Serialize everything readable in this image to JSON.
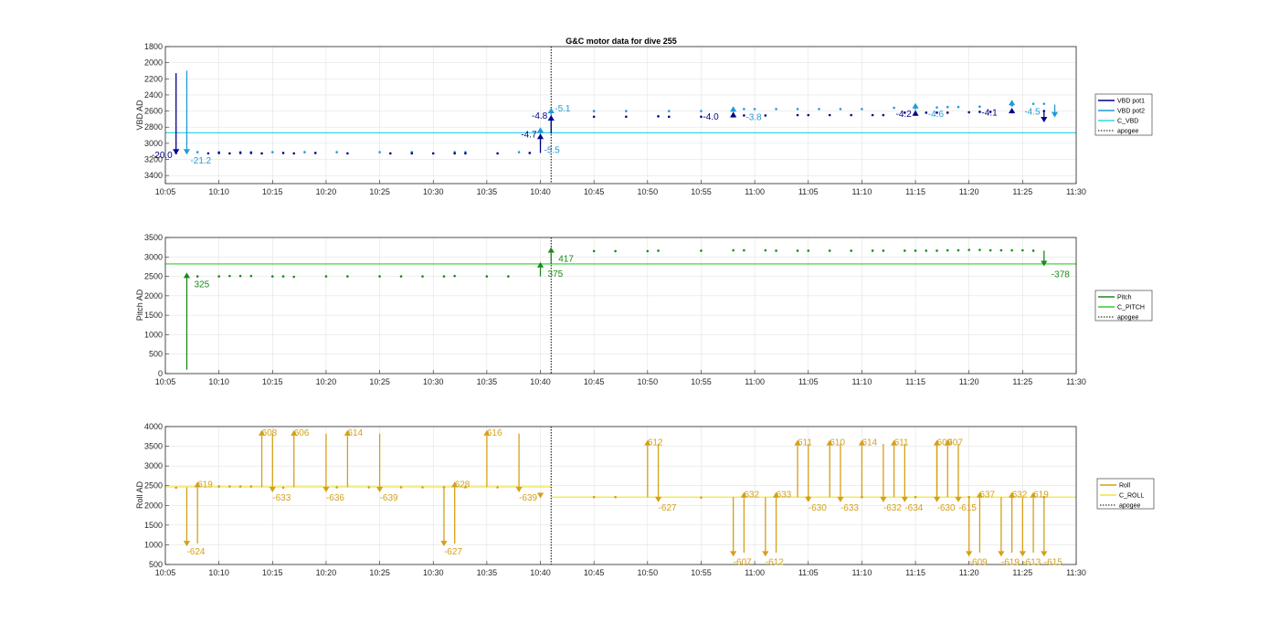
{
  "chart_data": [
    {
      "type": "line",
      "id": "vbd",
      "title": "G&C motor data for dive 255",
      "xlabel": "",
      "ylabel": "VBD AD",
      "x_ticks": [
        "10:05",
        "10:10",
        "10:15",
        "10:20",
        "10:25",
        "10:30",
        "10:35",
        "10:40",
        "10:45",
        "10:50",
        "10:55",
        "11:00",
        "11:05",
        "11:10",
        "11:15",
        "11:20",
        "11:25",
        "11:30"
      ],
      "xlim": [
        "10:05",
        "11:30"
      ],
      "ylim": [
        1800,
        3500
      ],
      "y_reversed": true,
      "y_ticks": [
        1800,
        2000,
        2200,
        2400,
        2600,
        2800,
        3000,
        3200,
        3400
      ],
      "grid": true,
      "legend_position": "right",
      "legend": [
        {
          "label": "VBD pot1",
          "color": "#00008b",
          "style": "solid"
        },
        {
          "label": "VBD pot2",
          "color": "#1f9bd8",
          "style": "solid"
        },
        {
          "label": "C_VBD",
          "color": "#33d6e6",
          "style": "solid"
        },
        {
          "label": "apogee",
          "color": "#000000",
          "style": "dotted"
        }
      ],
      "c_vbd": 2870,
      "apogee_x": "10:41",
      "pot1_points": [
        [
          "10:06",
          3120
        ],
        [
          "10:09",
          3125
        ],
        [
          "10:10",
          3120
        ],
        [
          "10:11",
          3125
        ],
        [
          "10:12",
          3120
        ],
        [
          "10:13",
          3120
        ],
        [
          "10:14",
          3125
        ],
        [
          "10:16",
          3120
        ],
        [
          "10:17",
          3125
        ],
        [
          "10:19",
          3120
        ],
        [
          "10:22",
          3125
        ],
        [
          "10:26",
          3125
        ],
        [
          "10:28",
          3125
        ],
        [
          "10:30",
          3125
        ],
        [
          "10:32",
          3125
        ],
        [
          "10:33",
          3125
        ],
        [
          "10:36",
          3125
        ],
        [
          "10:39",
          3120
        ],
        [
          "10:45",
          2670
        ],
        [
          "10:48",
          2670
        ],
        [
          "10:51",
          2665
        ],
        [
          "10:52",
          2670
        ],
        [
          "10:55",
          2670
        ],
        [
          "10:58",
          2660
        ],
        [
          "10:59",
          2655
        ],
        [
          "11:01",
          2655
        ],
        [
          "11:04",
          2650
        ],
        [
          "11:05",
          2650
        ],
        [
          "11:07",
          2650
        ],
        [
          "11:09",
          2650
        ],
        [
          "11:11",
          2650
        ],
        [
          "11:12",
          2650
        ],
        [
          "11:14",
          2620
        ],
        [
          "11:15",
          2620
        ],
        [
          "11:16",
          2620
        ],
        [
          "11:17",
          2620
        ],
        [
          "11:18",
          2620
        ],
        [
          "11:20",
          2615
        ],
        [
          "11:21",
          2610
        ],
        [
          "11:22",
          2610
        ],
        [
          "11:24",
          2600
        ],
        [
          "11:27",
          2600
        ]
      ],
      "pot2_points": [
        [
          "10:07",
          3110
        ],
        [
          "10:08",
          3110
        ],
        [
          "10:10",
          3110
        ],
        [
          "10:12",
          3110
        ],
        [
          "10:13",
          3110
        ],
        [
          "10:15",
          3110
        ],
        [
          "10:18",
          3110
        ],
        [
          "10:21",
          3110
        ],
        [
          "10:25",
          3110
        ],
        [
          "10:28",
          3110
        ],
        [
          "10:32",
          3110
        ],
        [
          "10:33",
          3110
        ],
        [
          "10:38",
          3110
        ],
        [
          "10:45",
          2600
        ],
        [
          "10:48",
          2600
        ],
        [
          "10:52",
          2600
        ],
        [
          "10:55",
          2600
        ],
        [
          "10:59",
          2575
        ],
        [
          "11:00",
          2575
        ],
        [
          "11:02",
          2575
        ],
        [
          "11:04",
          2575
        ],
        [
          "11:06",
          2575
        ],
        [
          "11:08",
          2575
        ],
        [
          "11:10",
          2575
        ],
        [
          "11:13",
          2560
        ],
        [
          "11:17",
          2555
        ],
        [
          "11:18",
          2550
        ],
        [
          "11:19",
          2550
        ],
        [
          "11:21",
          2545
        ],
        [
          "11:24",
          2530
        ],
        [
          "11:26",
          2510
        ],
        [
          "11:27",
          2510
        ]
      ],
      "pot1_arrows": [
        {
          "x": "10:06",
          "y_start": 2130,
          "y_end": 3140,
          "label": "-20.0",
          "label_at": "end"
        },
        {
          "x": "10:40",
          "y_start": 3120,
          "y_end": 2880,
          "label": "-4.7",
          "label_at": "end"
        },
        {
          "x": "10:41",
          "y_start": 2880,
          "y_end": 2650,
          "label": "-4.8",
          "label_at": "end"
        },
        {
          "x": "10:58",
          "y_start": 2680,
          "y_end": 2610,
          "label": "",
          "label_at": "end"
        },
        {
          "x": "11:15",
          "y_start": 2660,
          "y_end": 2590,
          "label": "",
          "label_at": "end"
        },
        {
          "x": "11:24",
          "y_start": 2630,
          "y_end": 2560,
          "label": "",
          "label_at": "end"
        },
        {
          "x": "11:27",
          "y_start": 2600,
          "y_end": 2740,
          "label": "",
          "label_at": "end"
        }
      ],
      "pot2_arrows": [
        {
          "x": "10:07",
          "y_start": 2100,
          "y_end": 3140,
          "label": "-21.2",
          "label_at": "end"
        },
        {
          "x": "10:40",
          "y_start": 3020,
          "y_end": 2800,
          "label": "-5.5",
          "label_at": "start"
        },
        {
          "x": "10:41",
          "y_start": 2860,
          "y_end": 2560,
          "label": "-5.1",
          "label_at": "end"
        },
        {
          "x": "10:58",
          "y_start": 2620,
          "y_end": 2540,
          "label": "",
          "label_at": "end"
        },
        {
          "x": "11:15",
          "y_start": 2590,
          "y_end": 2500,
          "label": "",
          "label_at": "end"
        },
        {
          "x": "11:24",
          "y_start": 2540,
          "y_end": 2460,
          "label": "",
          "label_at": "end"
        },
        {
          "x": "11:28",
          "y_start": 2520,
          "y_end": 2680,
          "label": "",
          "label_at": "end"
        }
      ],
      "extra_labels": [
        {
          "x": "10:55",
          "y": 2660,
          "text": "-4.0",
          "color": "#00008b"
        },
        {
          "x": "10:59",
          "y": 2665,
          "text": "-3.8",
          "color": "#1f9bd8"
        },
        {
          "x": "11:13",
          "y": 2630,
          "text": "-4.2",
          "color": "#00008b"
        },
        {
          "x": "11:16",
          "y": 2630,
          "text": "-4.6",
          "color": "#1f9bd8"
        },
        {
          "x": "11:21",
          "y": 2610,
          "text": "-4.1",
          "color": "#00008b"
        },
        {
          "x": "11:25",
          "y": 2600,
          "text": "-4.5",
          "color": "#1f9bd8"
        }
      ]
    },
    {
      "type": "line",
      "id": "pitch",
      "title": "",
      "xlabel": "",
      "ylabel": "Pitch AD",
      "x_ticks": [
        "10:05",
        "10:10",
        "10:15",
        "10:20",
        "10:25",
        "10:30",
        "10:35",
        "10:40",
        "10:45",
        "10:50",
        "10:55",
        "11:00",
        "11:05",
        "11:10",
        "11:15",
        "11:20",
        "11:25",
        "11:30"
      ],
      "xlim": [
        "10:05",
        "11:30"
      ],
      "ylim": [
        0,
        3500
      ],
      "y_reversed": false,
      "y_ticks": [
        0,
        500,
        1000,
        1500,
        2000,
        2500,
        3000,
        3500
      ],
      "grid": true,
      "legend_position": "right",
      "legend": [
        {
          "label": "Pitch",
          "color": "#1a8a1a",
          "style": "solid"
        },
        {
          "label": "C_PITCH",
          "color": "#33cc33",
          "style": "solid"
        },
        {
          "label": "apogee",
          "color": "#000000",
          "style": "dotted"
        }
      ],
      "c_pitch": 2820,
      "apogee_x": "10:41",
      "points": [
        [
          "10:08",
          2500
        ],
        [
          "10:10",
          2500
        ],
        [
          "10:11",
          2510
        ],
        [
          "10:12",
          2510
        ],
        [
          "10:13",
          2510
        ],
        [
          "10:15",
          2500
        ],
        [
          "10:16",
          2500
        ],
        [
          "10:17",
          2490
        ],
        [
          "10:20",
          2500
        ],
        [
          "10:22",
          2500
        ],
        [
          "10:25",
          2500
        ],
        [
          "10:27",
          2500
        ],
        [
          "10:29",
          2500
        ],
        [
          "10:31",
          2500
        ],
        [
          "10:32",
          2510
        ],
        [
          "10:35",
          2500
        ],
        [
          "10:37",
          2500
        ],
        [
          "10:45",
          3150
        ],
        [
          "10:47",
          3150
        ],
        [
          "10:50",
          3150
        ],
        [
          "10:51",
          3160
        ],
        [
          "10:55",
          3160
        ],
        [
          "10:58",
          3170
        ],
        [
          "10:59",
          3170
        ],
        [
          "11:01",
          3170
        ],
        [
          "11:02",
          3160
        ],
        [
          "11:04",
          3160
        ],
        [
          "11:05",
          3160
        ],
        [
          "11:07",
          3160
        ],
        [
          "11:09",
          3160
        ],
        [
          "11:11",
          3160
        ],
        [
          "11:12",
          3160
        ],
        [
          "11:14",
          3160
        ],
        [
          "11:15",
          3160
        ],
        [
          "11:16",
          3160
        ],
        [
          "11:17",
          3160
        ],
        [
          "11:18",
          3170
        ],
        [
          "11:19",
          3170
        ],
        [
          "11:20",
          3180
        ],
        [
          "11:21",
          3180
        ],
        [
          "11:22",
          3170
        ],
        [
          "11:23",
          3170
        ],
        [
          "11:24",
          3170
        ],
        [
          "11:25",
          3170
        ],
        [
          "11:26",
          3160
        ]
      ],
      "arrows": [
        {
          "x": "10:07",
          "y_start": 100,
          "y_end": 2600,
          "label": "325"
        },
        {
          "x": "10:40",
          "y_start": 2500,
          "y_end": 2870,
          "label": "375"
        },
        {
          "x": "10:41",
          "y_start": 2870,
          "y_end": 3250,
          "label": "417"
        },
        {
          "x": "11:27",
          "y_start": 3160,
          "y_end": 2760,
          "label": "-378"
        }
      ]
    },
    {
      "type": "line",
      "id": "roll",
      "title": "",
      "xlabel": "",
      "ylabel": "Roll AD",
      "x_ticks": [
        "10:05",
        "10:10",
        "10:15",
        "10:20",
        "10:25",
        "10:30",
        "10:35",
        "10:40",
        "10:45",
        "10:50",
        "10:55",
        "11:00",
        "11:05",
        "11:10",
        "11:15",
        "11:20",
        "11:25",
        "11:30"
      ],
      "xlim": [
        "10:05",
        "11:30"
      ],
      "ylim": [
        500,
        4000
      ],
      "y_reversed": false,
      "y_ticks": [
        500,
        1000,
        1500,
        2000,
        2500,
        3000,
        3500,
        4000
      ],
      "grid": true,
      "legend_position": "right",
      "legend": [
        {
          "label": "Roll",
          "color": "#d4a017",
          "style": "solid"
        },
        {
          "label": "C_ROLL",
          "color": "#f0e442",
          "style": "solid"
        },
        {
          "label": "apogee",
          "color": "#000000",
          "style": "dotted"
        }
      ],
      "c_roll_before": 2470,
      "c_roll_after": 2210,
      "apogee_x": "10:41",
      "points": [
        [
          "10:06",
          2450
        ],
        [
          "10:10",
          2480
        ],
        [
          "10:11",
          2480
        ],
        [
          "10:12",
          2480
        ],
        [
          "10:13",
          2480
        ],
        [
          "10:16",
          2450
        ],
        [
          "10:21",
          2460
        ],
        [
          "10:24",
          2460
        ],
        [
          "10:27",
          2460
        ],
        [
          "10:29",
          2460
        ],
        [
          "10:31",
          2460
        ],
        [
          "10:33",
          2460
        ],
        [
          "10:36",
          2460
        ],
        [
          "10:45",
          2210
        ],
        [
          "10:47",
          2210
        ],
        [
          "10:55",
          2200
        ],
        [
          "11:05",
          2210
        ],
        [
          "11:10",
          2210
        ],
        [
          "11:15",
          2210
        ],
        [
          "11:20",
          2210
        ],
        [
          "11:24",
          2210
        ],
        [
          "11:27",
          2210
        ]
      ],
      "arrows": [
        {
          "x": "10:07",
          "y_start": 2460,
          "y_end": 960,
          "label": "-624"
        },
        {
          "x": "10:08",
          "y_start": 1030,
          "y_end": 2600,
          "label": "619"
        },
        {
          "x": "10:14",
          "y_start": 2460,
          "y_end": 3910,
          "label": "608"
        },
        {
          "x": "10:15",
          "y_start": 3820,
          "y_end": 2330,
          "label": "-633"
        },
        {
          "x": "10:17",
          "y_start": 2460,
          "y_end": 3910,
          "label": "606"
        },
        {
          "x": "10:20",
          "y_start": 3820,
          "y_end": 2330,
          "label": "-636"
        },
        {
          "x": "10:22",
          "y_start": 2460,
          "y_end": 3910,
          "label": "614"
        },
        {
          "x": "10:25",
          "y_start": 3820,
          "y_end": 2330,
          "label": "-639"
        },
        {
          "x": "10:31",
          "y_start": 2460,
          "y_end": 960,
          "label": "-627"
        },
        {
          "x": "10:32",
          "y_start": 1030,
          "y_end": 2600,
          "label": "628"
        },
        {
          "x": "10:35",
          "y_start": 2460,
          "y_end": 3910,
          "label": "616"
        },
        {
          "x": "10:38",
          "y_start": 3820,
          "y_end": 2330,
          "label": "-639"
        },
        {
          "x": "10:40",
          "y_start": 2260,
          "y_end": 2180,
          "label": ""
        },
        {
          "x": "10:50",
          "y_start": 2210,
          "y_end": 3660,
          "label": "612"
        },
        {
          "x": "10:51",
          "y_start": 3560,
          "y_end": 2080,
          "label": "-627"
        },
        {
          "x": "10:58",
          "y_start": 2210,
          "y_end": 700,
          "label": "-607"
        },
        {
          "x": "10:59",
          "y_start": 800,
          "y_end": 2340,
          "label": "632"
        },
        {
          "x": "11:01",
          "y_start": 2210,
          "y_end": 700,
          "label": "-612"
        },
        {
          "x": "11:02",
          "y_start": 800,
          "y_end": 2340,
          "label": "633"
        },
        {
          "x": "11:04",
          "y_start": 2210,
          "y_end": 3660,
          "label": "611"
        },
        {
          "x": "11:05",
          "y_start": 3560,
          "y_end": 2080,
          "label": "-630"
        },
        {
          "x": "11:07",
          "y_start": 2210,
          "y_end": 3660,
          "label": "610"
        },
        {
          "x": "11:08",
          "y_start": 3560,
          "y_end": 2080,
          "label": "-633"
        },
        {
          "x": "11:10",
          "y_start": 2210,
          "y_end": 3660,
          "label": "614"
        },
        {
          "x": "11:12",
          "y_start": 3560,
          "y_end": 2080,
          "label": "-632"
        },
        {
          "x": "11:13",
          "y_start": 2210,
          "y_end": 3660,
          "label": "611"
        },
        {
          "x": "11:14",
          "y_start": 3560,
          "y_end": 2080,
          "label": "-634"
        },
        {
          "x": "11:17",
          "y_start": 2210,
          "y_end": 3660,
          "label": "609"
        },
        {
          "x": "11:17",
          "y_start": 3560,
          "y_end": 2080,
          "label": "-630"
        },
        {
          "x": "11:18",
          "y_start": 2210,
          "y_end": 3660,
          "label": "607"
        },
        {
          "x": "11:19",
          "y_start": 3560,
          "y_end": 2080,
          "label": "-615"
        },
        {
          "x": "11:20",
          "y_start": 2210,
          "y_end": 700,
          "label": "-609"
        },
        {
          "x": "11:21",
          "y_start": 800,
          "y_end": 2340,
          "label": "637"
        },
        {
          "x": "11:23",
          "y_start": 2210,
          "y_end": 700,
          "label": "-619"
        },
        {
          "x": "11:24",
          "y_start": 800,
          "y_end": 2340,
          "label": "632"
        },
        {
          "x": "11:25",
          "y_start": 2210,
          "y_end": 700,
          "label": "-613"
        },
        {
          "x": "11:26",
          "y_start": 800,
          "y_end": 2340,
          "label": "619"
        },
        {
          "x": "11:27",
          "y_start": 2210,
          "y_end": 700,
          "label": "-615"
        }
      ]
    }
  ]
}
